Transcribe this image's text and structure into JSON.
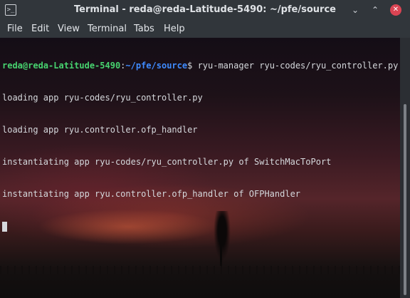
{
  "window": {
    "title": "Terminal - reda@reda-Latitude-5490: ~/pfe/source",
    "app_icon_glyph": ">_",
    "controls": {
      "minimize_glyph": "⌄",
      "maximize_glyph": "⌃",
      "close_glyph": "✕",
      "close_color": "#da4453"
    }
  },
  "menu": {
    "items": [
      "File",
      "Edit",
      "View",
      "Terminal",
      "Tabs",
      "Help"
    ]
  },
  "terminal": {
    "prompt": {
      "user_host": "reda@reda-Latitude-5490",
      "separator": ":",
      "path": "~/pfe/source",
      "symbol": "$ ",
      "command": "ryu-manager ryu-codes/ryu_controller.py"
    },
    "output": [
      "loading app ryu-codes/ryu_controller.py",
      "loading app ryu.controller.ofp_handler",
      "instantiating app ryu-codes/ryu_controller.py of SwitchMacToPort",
      "instantiating app ryu.controller.ofp_handler of OFPHandler"
    ],
    "colors": {
      "prompt_user": "#47d36f",
      "prompt_path": "#3f8bff",
      "text": "#d5d8dc"
    }
  }
}
